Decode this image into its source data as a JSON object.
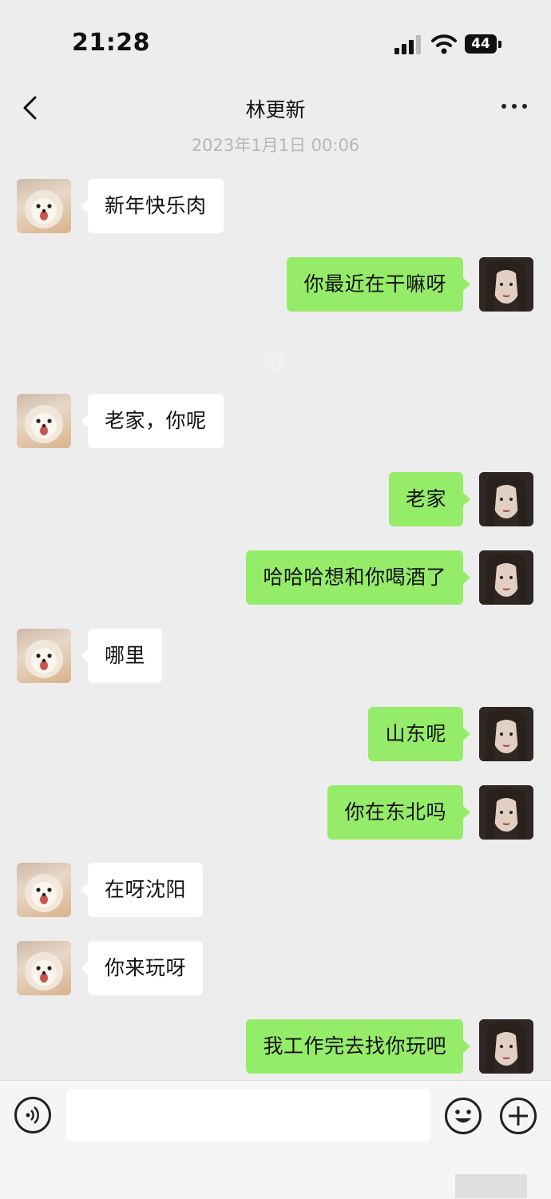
{
  "status_bar": {
    "time": "21:28",
    "battery": "44"
  },
  "nav": {
    "title": "林更新"
  },
  "timestamp": "2023年1月1日 00:06",
  "watermark": "@",
  "messages": [
    {
      "side": "in",
      "text": "新年快乐肉"
    },
    {
      "side": "out",
      "text": "你最近在干嘛呀"
    },
    {
      "side": "in",
      "text": "老家，你呢"
    },
    {
      "side": "out",
      "text": "老家"
    },
    {
      "side": "out",
      "text": "哈哈哈想和你喝酒了"
    },
    {
      "side": "in",
      "text": "哪里"
    },
    {
      "side": "out",
      "text": "山东呢"
    },
    {
      "side": "out",
      "text": "你在东北吗"
    },
    {
      "side": "in",
      "text": "在呀沈阳"
    },
    {
      "side": "in",
      "text": "你来玩呀"
    },
    {
      "side": "out",
      "text": "我工作完去找你玩吧"
    }
  ],
  "input": {
    "value": ""
  },
  "icons": {
    "back": "chevron-left-icon",
    "more": "more-dots-icon",
    "voice": "voice-icon",
    "emoji": "emoji-icon",
    "plus": "plus-icon",
    "contact_avatar": "dog-avatar",
    "self_avatar": "girl-avatar"
  },
  "colors": {
    "outgoing_bubble": "#95ec69",
    "incoming_bubble": "#ffffff",
    "background": "#ededed"
  }
}
